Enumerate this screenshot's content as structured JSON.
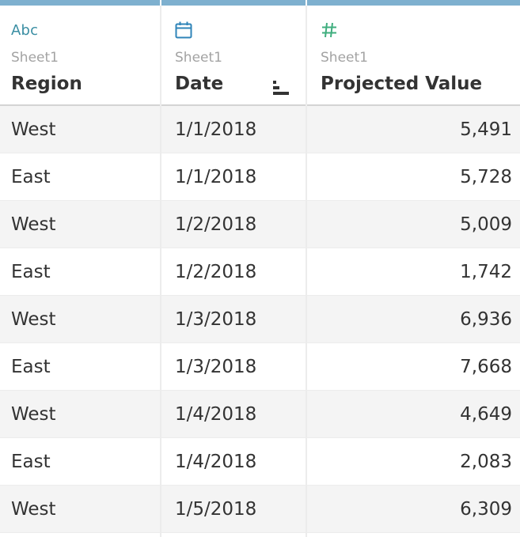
{
  "columns": [
    {
      "type_label": "Abc",
      "type_icon": "string-type-icon",
      "source": "Sheet1",
      "name": "Region"
    },
    {
      "type_label": "",
      "type_icon": "calendar-icon",
      "source": "Sheet1",
      "name": "Date"
    },
    {
      "type_label": "#",
      "type_icon": "number-type-icon",
      "source": "Sheet1",
      "name": "Projected Value"
    }
  ],
  "rows": [
    {
      "region": "West",
      "date": "1/1/2018",
      "value": "5,491"
    },
    {
      "region": "East",
      "date": "1/1/2018",
      "value": "5,728"
    },
    {
      "region": "West",
      "date": "1/2/2018",
      "value": "5,009"
    },
    {
      "region": "East",
      "date": "1/2/2018",
      "value": "1,742"
    },
    {
      "region": "West",
      "date": "1/3/2018",
      "value": "6,936"
    },
    {
      "region": "East",
      "date": "1/3/2018",
      "value": "7,668"
    },
    {
      "region": "West",
      "date": "1/4/2018",
      "value": "4,649"
    },
    {
      "region": "East",
      "date": "1/4/2018",
      "value": "2,083"
    },
    {
      "region": "West",
      "date": "1/5/2018",
      "value": "6,309"
    }
  ],
  "colors": {
    "header_accent": "#7eb0cf",
    "string_type": "#3a8ea3",
    "date_type": "#2f84b8",
    "number_type": "#3fae7e",
    "row_stripe": "#f4f4f4",
    "text": "#333333"
  }
}
